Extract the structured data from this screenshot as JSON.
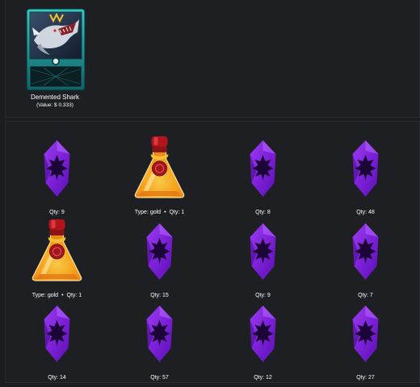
{
  "card": {
    "name": "Demented Shark",
    "value_text": "(Value: $ 0.333)"
  },
  "items": [
    {
      "kind": "rune",
      "qty_label": "Qty: 9"
    },
    {
      "kind": "potion",
      "type_label": "Type: gold",
      "qty_label": "Qty: 1"
    },
    {
      "kind": "rune",
      "qty_label": "Qty: 8"
    },
    {
      "kind": "rune",
      "qty_label": "Qty: 48"
    },
    {
      "kind": "potion",
      "type_label": "Type: gold",
      "qty_label": "Qty: 1"
    },
    {
      "kind": "rune",
      "qty_label": "Qty: 15"
    },
    {
      "kind": "rune",
      "qty_label": "Qty: 9"
    },
    {
      "kind": "rune",
      "qty_label": "Qty: 7"
    },
    {
      "kind": "rune",
      "qty_label": "Qty: 14"
    },
    {
      "kind": "rune",
      "qty_label": "Qty: 57"
    },
    {
      "kind": "rune",
      "qty_label": "Qty: 12"
    },
    {
      "kind": "rune",
      "qty_label": "Qty: 27"
    }
  ],
  "colors": {
    "background": "#1b1d21",
    "rune_purple": "#7a1fd6",
    "rune_dark": "#2a0a55",
    "potion_orange": "#f7a21b",
    "potion_red": "#b3141b",
    "card_teal": "#1f9a9a"
  }
}
